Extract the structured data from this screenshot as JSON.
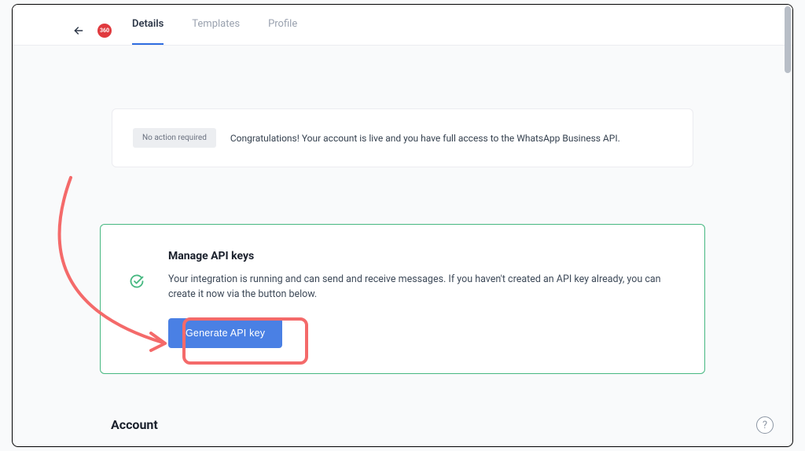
{
  "logo_text": "360",
  "tabs": {
    "details": "Details",
    "templates": "Templates",
    "profile": "Profile"
  },
  "status": {
    "badge": "No action required",
    "message": "Congratulations! Your account is live and you have full access to the WhatsApp Business API."
  },
  "api": {
    "title": "Manage API keys",
    "description": "Your integration is running and can send and receive messages. If you haven't created an API key already, you can create it now via the button below.",
    "button_label": "Generate API key"
  },
  "sections": {
    "account_heading": "Account"
  },
  "help_symbol": "?"
}
